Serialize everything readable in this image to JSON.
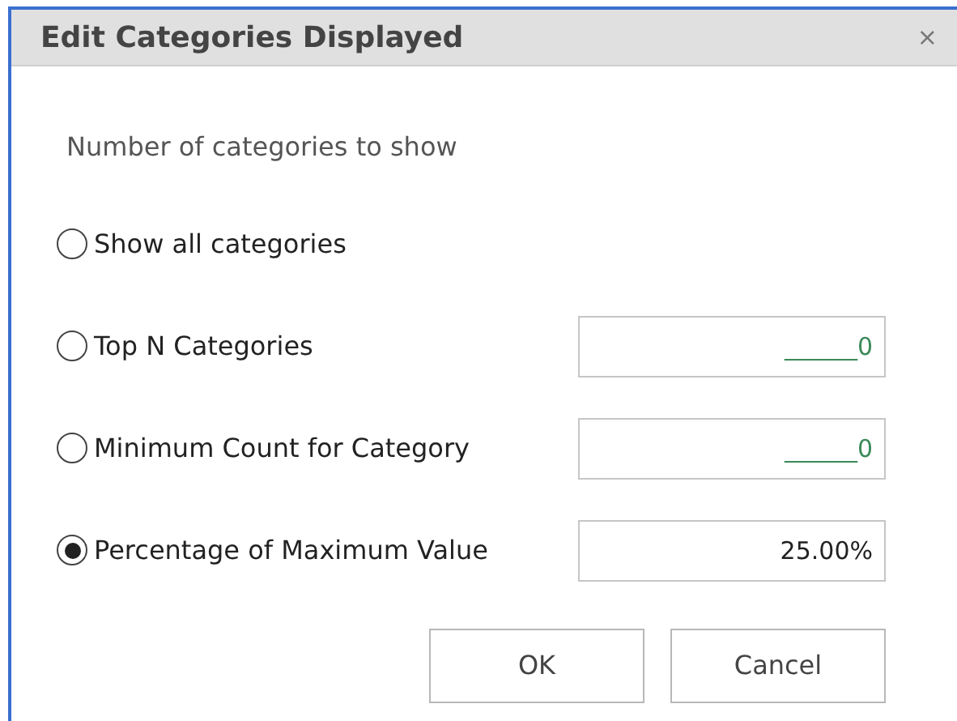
{
  "window": {
    "title": "Edit Categories Displayed",
    "close": "×"
  },
  "heading": "Number of categories to show",
  "options": [
    {
      "label": "Show all categories",
      "selected": false
    },
    {
      "label": "Top N Categories",
      "selected": false,
      "field": {
        "value": "______0",
        "masked": true
      }
    },
    {
      "label": "Minimum Count for Category",
      "selected": false,
      "field": {
        "value": "______0",
        "masked": true
      }
    },
    {
      "label": "Percentage of Maximum Value",
      "selected": true,
      "field": {
        "value": "25.00%",
        "masked": false
      }
    }
  ],
  "buttons": [
    "OK",
    "Cancel"
  ]
}
